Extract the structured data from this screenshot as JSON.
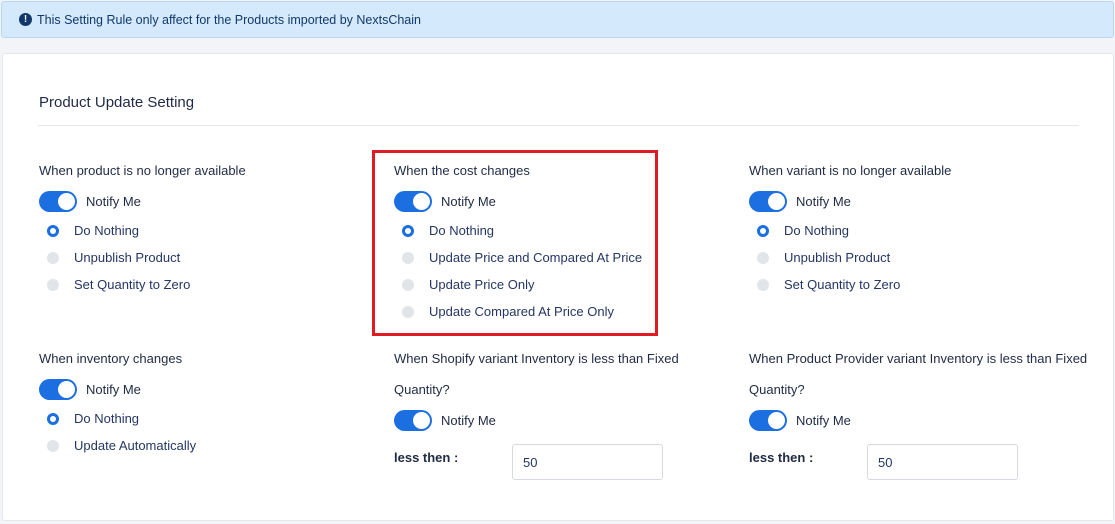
{
  "alert": {
    "icon": "exclamation-circle-icon",
    "text": "This Setting Rule only affect for the Products imported by NextsChain"
  },
  "card": {
    "title": "Product Update Setting"
  },
  "sections": {
    "unavailable": {
      "title": "When product is no longer available",
      "toggle_label": "Notify Me",
      "toggle_on": true,
      "options": [
        "Do Nothing",
        "Unpublish Product",
        "Set Quantity to Zero"
      ],
      "selected": "Do Nothing"
    },
    "cost": {
      "title": "When the cost changes",
      "toggle_label": "Notify Me",
      "toggle_on": true,
      "options": [
        "Do Nothing",
        "Update Price and Compared At Price",
        "Update Price Only",
        "Update Compared At Price Only"
      ],
      "selected": "Do Nothing"
    },
    "variant": {
      "title": "When variant is no longer available",
      "toggle_label": "Notify Me",
      "toggle_on": true,
      "options": [
        "Do Nothing",
        "Unpublish Product",
        "Set Quantity to Zero"
      ],
      "selected": "Do Nothing"
    },
    "inventory": {
      "title": "When inventory changes",
      "toggle_label": "Notify Me",
      "toggle_on": true,
      "options": [
        "Do Nothing",
        "Update Automatically"
      ],
      "selected": "Do Nothing"
    },
    "shopify": {
      "title_line1": "When Shopify variant Inventory is less than Fixed",
      "title_line2": "Quantity?",
      "toggle_label": "Notify Me",
      "toggle_on": true,
      "less_label": "less then :",
      "value": "50"
    },
    "provider": {
      "title_line1": "When Product Provider variant Inventory is less than Fixed",
      "title_line2": "Quantity?",
      "toggle_label": "Notify Me",
      "toggle_on": true,
      "less_label": "less then :",
      "value": "50"
    }
  },
  "colors": {
    "accent": "#1b6fe0",
    "highlight_border": "#e01b24",
    "alert_bg": "#d4e9fb"
  }
}
